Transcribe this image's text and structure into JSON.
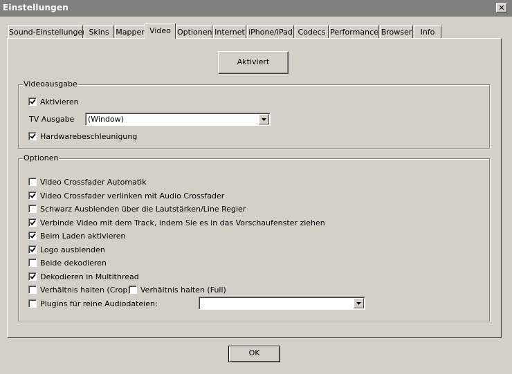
{
  "window": {
    "title": "Einstellungen",
    "close_glyph": "✕"
  },
  "tabs": [
    {
      "label": "Sound-Einstellungen",
      "active": false
    },
    {
      "label": "Skins",
      "active": false
    },
    {
      "label": "Mapper",
      "active": false
    },
    {
      "label": "Video",
      "active": true
    },
    {
      "label": "Optionen",
      "active": false
    },
    {
      "label": "Internet",
      "active": false
    },
    {
      "label": "iPhone/iPad",
      "active": false
    },
    {
      "label": "Codecs",
      "active": false
    },
    {
      "label": "Performance",
      "active": false
    },
    {
      "label": "Browser",
      "active": false
    },
    {
      "label": "Info",
      "active": false
    }
  ],
  "activated_button": "Aktiviert",
  "videoausgabe": {
    "legend": "Videoausgabe",
    "aktivieren": {
      "label": "Aktivieren",
      "checked": true
    },
    "tv_label": "TV Ausgabe",
    "tv_value": "(Window)",
    "hardware": {
      "label": "Hardwarebeschleunigung",
      "checked": true
    }
  },
  "optionen": {
    "legend": "Optionen",
    "items": [
      {
        "label": "Video Crossfader Automatik",
        "checked": false
      },
      {
        "label": "Video Crossfader verlinken mit Audio Crossfader",
        "checked": true
      },
      {
        "label": "Schwarz Ausblenden über die Lautstärken/Line Regler",
        "checked": false
      },
      {
        "label": "Verbinde Video mit dem Track, indem Sie es in das Vorschaufenster ziehen",
        "checked": true
      },
      {
        "label": "Beim Laden aktivieren",
        "checked": true
      },
      {
        "label": "Logo ausblenden",
        "checked": true
      },
      {
        "label": "Beide dekodieren",
        "checked": false
      },
      {
        "label": "Dekodieren in Multithread",
        "checked": true
      }
    ],
    "crop": {
      "label": "Verhältnis halten (Crop)",
      "checked": false
    },
    "full": {
      "label": "Verhältnis halten (Full)",
      "checked": false
    },
    "plugins": {
      "label": "Plugins für reine Audiodateien:",
      "checked": false,
      "value": ""
    }
  },
  "ok_button": "OK",
  "icons": {
    "check": "checkmark-icon",
    "dropdown": "dropdown-arrow-icon",
    "close": "close-icon"
  }
}
